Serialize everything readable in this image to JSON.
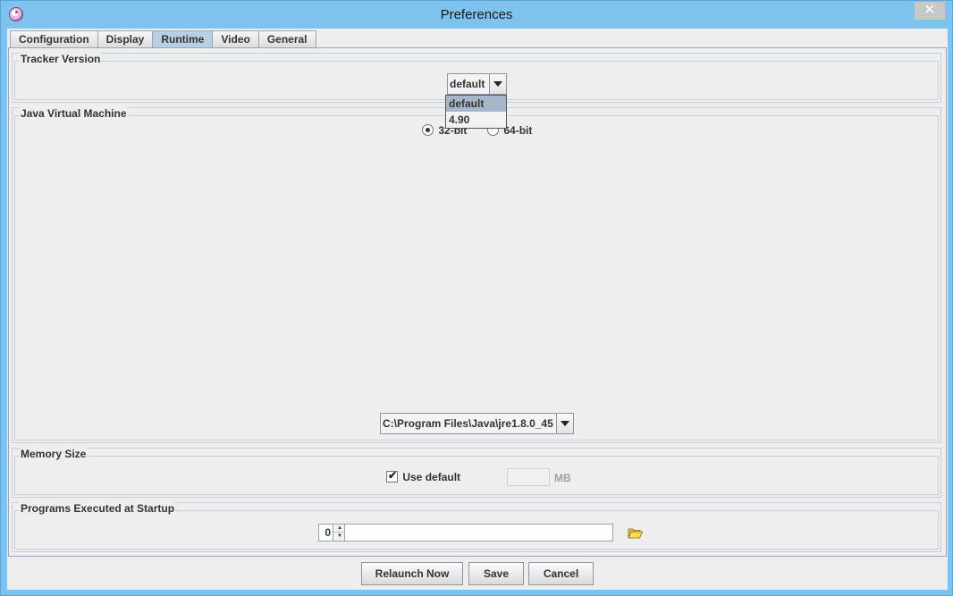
{
  "window": {
    "title": "Preferences",
    "close_glyph": "✕"
  },
  "tabs": [
    {
      "label": "Configuration",
      "active": false
    },
    {
      "label": "Display",
      "active": false
    },
    {
      "label": "Runtime",
      "active": true
    },
    {
      "label": "Video",
      "active": false
    },
    {
      "label": "General",
      "active": false
    }
  ],
  "tracker_version": {
    "title": "Tracker Version",
    "selected": "default",
    "options": [
      "default",
      "4.90"
    ],
    "highlighted_option": "default"
  },
  "jvm": {
    "title": "Java Virtual Machine",
    "radio_32_label": "32-bit",
    "radio_64_label": "64-bit",
    "selected_bitness": "32-bit",
    "jre_path": "C:\\Program Files\\Java\\jre1.8.0_45"
  },
  "memory": {
    "title": "Memory Size",
    "use_default_label": "Use default",
    "use_default_checked": true,
    "value": "",
    "unit": "MB"
  },
  "startup": {
    "title": "Programs Executed at Startup",
    "index_value": "0",
    "program_path": ""
  },
  "buttons": {
    "relaunch": "Relaunch Now",
    "save": "Save",
    "cancel": "Cancel"
  },
  "icons": {
    "app": "tracker-app-icon",
    "folder": "open-folder-icon"
  },
  "colors": {
    "titlebar": "#7ec2ee",
    "active_tab": "#b8cfe5",
    "dropdown_highlight": "#a7b6c8"
  }
}
